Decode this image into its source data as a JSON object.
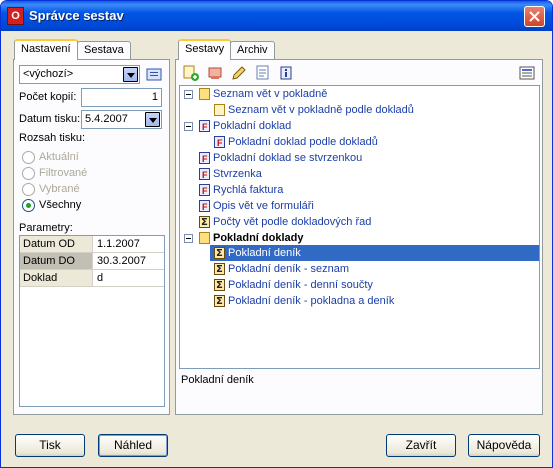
{
  "window": {
    "title": "Správce sestav",
    "app_icon_letter": "O"
  },
  "left_tabs": [
    {
      "label": "Nastavení"
    },
    {
      "label": "Sestava"
    }
  ],
  "settings": {
    "preset_value": "<výchozí>",
    "copies_label": "Počet kopií:",
    "copies_value": "1",
    "date_label": "Datum tisku:",
    "date_value": "5.4.2007",
    "range_label": "Rozsah tisku:",
    "range_options": [
      {
        "label": "Aktuální",
        "enabled": false
      },
      {
        "label": "Filtrované",
        "enabled": false
      },
      {
        "label": "Vybrané",
        "enabled": false
      },
      {
        "label": "Všechny",
        "enabled": true,
        "selected": true
      }
    ],
    "params_label": "Parametry:",
    "params": [
      {
        "key": "Datum OD",
        "value": "1.1.2007"
      },
      {
        "key": "Datum DO",
        "value": "30.3.2007"
      },
      {
        "key": "Doklad",
        "value": "d"
      }
    ]
  },
  "right_tabs": [
    {
      "label": "Sestavy"
    },
    {
      "label": "Archiv"
    }
  ],
  "tree": [
    {
      "label": "Seznam vět v pokladně",
      "icon": "folder-icon",
      "expanded": true
    },
    {
      "label": "Seznam vět v pokladně podle dokladů",
      "icon": "document-icon"
    },
    {
      "label": "Pokladní doklad",
      "icon": "form-icon",
      "expanded": true
    },
    {
      "label": "Pokladní doklad podle dokladů",
      "icon": "form-icon"
    },
    {
      "label": "Pokladní doklad se stvrzenkou",
      "icon": "form-icon"
    },
    {
      "label": "Stvrzenka",
      "icon": "form-icon"
    },
    {
      "label": "Rychlá faktura",
      "icon": "form-icon"
    },
    {
      "label": "Opis vět ve formuláři",
      "icon": "form-icon"
    },
    {
      "label": "Počty vět podle dokladových řad",
      "icon": "sum-icon"
    },
    {
      "label": "Pokladní doklady",
      "icon": "folder-icon",
      "expanded": true,
      "bold": true
    },
    {
      "label": "Pokladní deník",
      "icon": "sum-icon",
      "selected": true
    },
    {
      "label": "Pokladní deník - seznam",
      "icon": "sum-icon"
    },
    {
      "label": "Pokladní deník - denní součty",
      "icon": "sum-icon"
    },
    {
      "label": "Pokladní deník - pokladna a deník",
      "icon": "sum-icon"
    }
  ],
  "status": "Pokladní deník",
  "buttons": {
    "print": "Tisk",
    "preview": "Náhled",
    "close": "Zavřít",
    "help": "Nápověda"
  }
}
